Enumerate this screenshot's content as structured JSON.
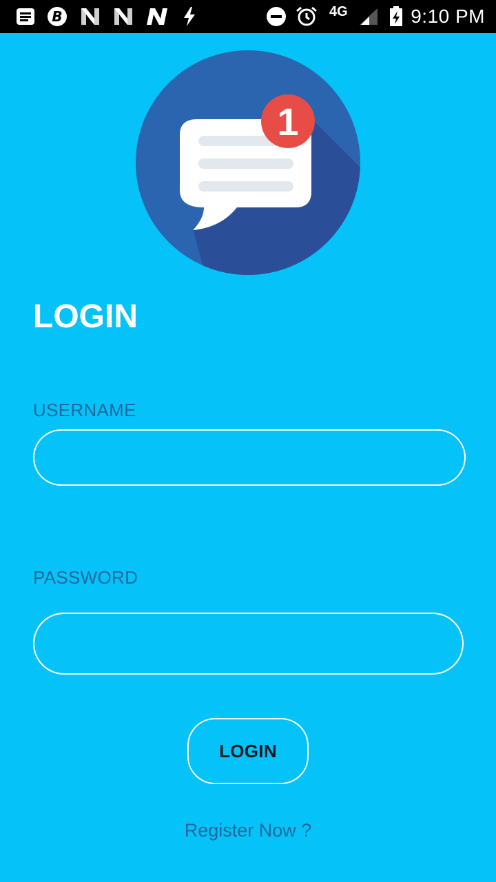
{
  "status_bar": {
    "network_type": "4G",
    "time": "9:10 PM",
    "icons": [
      "notes-icon",
      "bitcoin-icon",
      "n-app-icon",
      "n-app-icon",
      "n-app-icon",
      "charging-bolt-icon",
      "do-not-disturb-icon",
      "alarm-clock-icon",
      "signal-icon",
      "battery-charging-icon"
    ]
  },
  "logo": {
    "icon": "chat-message-icon",
    "badge_count": "1",
    "colors": {
      "circle": "#2b65b0",
      "shadow": "#2a4e98",
      "bubble": "#ffffff",
      "lines": "#e3e7ee",
      "badge": "#e84c46"
    }
  },
  "page": {
    "title": "LOGIN"
  },
  "form": {
    "username_label": "USERNAME",
    "username_value": "",
    "password_label": "PASSWORD",
    "password_value": "",
    "login_button": "LOGIN",
    "register_link": "Register Now ?"
  },
  "colors": {
    "background": "#05c3f8",
    "label_text": "#2268a0",
    "title_text": "#ffffff",
    "field_border": "#ffffff",
    "button_text": "#0a1a22"
  }
}
